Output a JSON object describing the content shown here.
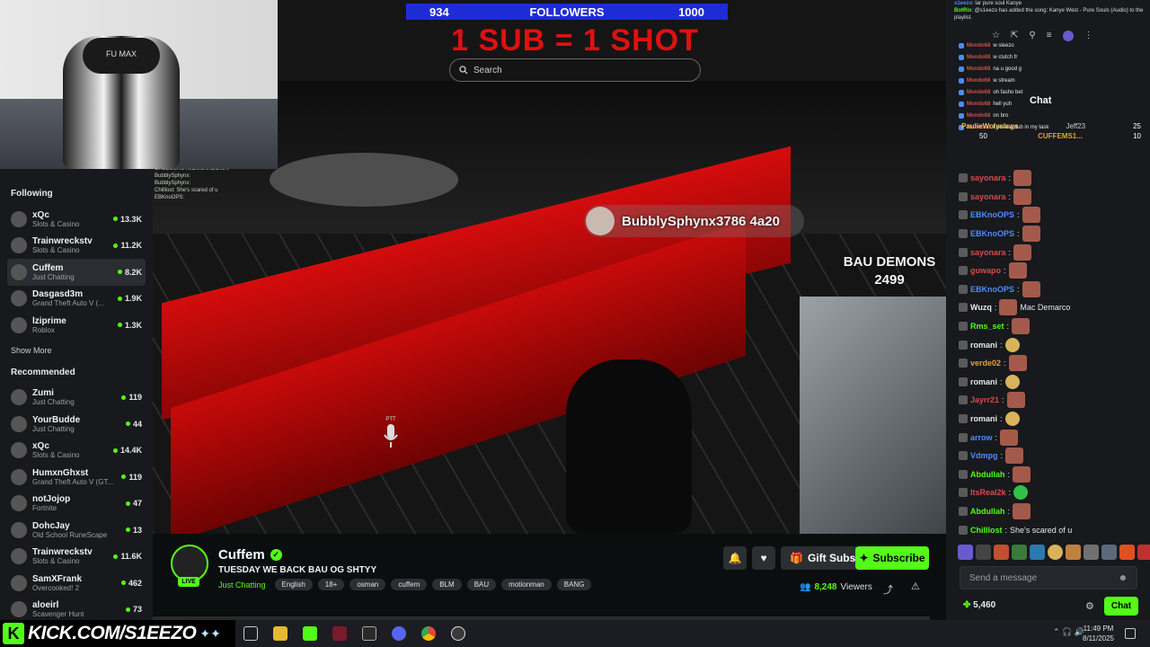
{
  "overlay": {
    "followers_current": "934",
    "followers_label": "FOLLOWERS",
    "followers_goal": "1000",
    "sub_text": "1 SUB = 1 SHOT",
    "search_placeholder": "Search",
    "nametag": "BubblySphynx3786 4a20",
    "bau_team": "BAU DEMONS",
    "bau_score": "2499",
    "chair_brand": "FU MAX",
    "mic_label": "PTT"
  },
  "sidebar": {
    "following_title": "Following",
    "following": [
      {
        "name": "xQc",
        "category": "Slots & Casino",
        "viewers": "13.3K"
      },
      {
        "name": "Trainwreckstv",
        "category": "Slots & Casino",
        "viewers": "11.2K"
      },
      {
        "name": "Cuffem",
        "category": "Just Chatting",
        "viewers": "8.2K"
      },
      {
        "name": "Dasgasd3m",
        "category": "Grand Theft Auto V (...",
        "viewers": "1.9K"
      },
      {
        "name": "lziprime",
        "category": "Roblox",
        "viewers": "1.3K"
      }
    ],
    "show_more": "Show More",
    "recommended_title": "Recommended",
    "recommended": [
      {
        "name": "Zumi",
        "category": "Just Chatting",
        "viewers": "119"
      },
      {
        "name": "YourBudde",
        "category": "Just Chatting",
        "viewers": "44"
      },
      {
        "name": "xQc",
        "category": "Slots & Casino",
        "viewers": "14.4K"
      },
      {
        "name": "HumxnGhxst",
        "category": "Grand Theft Auto V (GT...",
        "viewers": "119"
      },
      {
        "name": "notJojop",
        "category": "Fortnite",
        "viewers": "47"
      },
      {
        "name": "DohcJay",
        "category": "Old School RuneScape",
        "viewers": "13"
      },
      {
        "name": "Trainwreckstv",
        "category": "Slots & Casino",
        "viewers": "11.6K"
      },
      {
        "name": "SamXFrank",
        "category": "Overcooked! 2",
        "viewers": "462"
      },
      {
        "name": "aloeirl",
        "category": "Scavenger Hunt",
        "viewers": "73"
      }
    ]
  },
  "stream": {
    "streamer": "Cuffem",
    "live_badge": "LIVE",
    "title": "TUESDAY WE BACK BAU OG SHTYY",
    "category": "Just Chatting",
    "tags": [
      "English",
      "18+",
      "osman",
      "cuffem",
      "BLM",
      "BAU",
      "motionman",
      "BANG"
    ],
    "gift_label": "Gift Subs",
    "subscribe_label": "Subscribe",
    "viewers_count": "8,248",
    "viewers_label": "Viewers"
  },
  "chat": {
    "title": "Chat",
    "top_lines": [
      {
        "user": "s1eezo",
        "text": "lar pure soul Kanye"
      },
      {
        "user": "BotRix",
        "text": "@s1eezo has added the song: Kanye West - Pure Souls (Audio) to the playlist."
      }
    ],
    "small_lines": [
      {
        "user": "Mondo68",
        "text": "w sleezo"
      },
      {
        "user": "Mondo68",
        "text": "w clutch fr"
      },
      {
        "user": "Mondo68",
        "text": "na u good g"
      },
      {
        "user": "Mondo68",
        "text": "w stream"
      },
      {
        "user": "Mondo68",
        "text": "oh fasho bet"
      },
      {
        "user": "Mondo68",
        "text": "hell yuh"
      },
      {
        "user": "Mondo68",
        "text": "on bro"
      },
      {
        "user": "Mondo68",
        "text": "I need a dub in my task"
      }
    ],
    "pinned_left": "PaulieWolyslugs",
    "pinned_left_count": "50",
    "pinned_right_1": "Jeff23",
    "pinned_right_1_count": "25",
    "pinned_right_2": "CUFFEMS1...",
    "pinned_right_2_count": "10",
    "messages": [
      {
        "user": "sayonara",
        "color": "#d94a4a",
        "text": ""
      },
      {
        "user": "sayonara",
        "color": "#d94a4a",
        "text": ""
      },
      {
        "user": "EBKnoOPS",
        "color": "#4a8cff",
        "text": ""
      },
      {
        "user": "EBKnoOPS",
        "color": "#4a8cff",
        "text": ""
      },
      {
        "user": "sayonara",
        "color": "#d94a4a",
        "text": ""
      },
      {
        "user": "guwapo",
        "color": "#d94a4a",
        "text": ""
      },
      {
        "user": "EBKnoOPS",
        "color": "#4a8cff",
        "text": ""
      },
      {
        "user": "Wuzq",
        "color": "#e8e8e8",
        "text": "Mac Demarco"
      },
      {
        "user": "Rms_set",
        "color": "#53fc18",
        "text": ""
      },
      {
        "user": "romani",
        "color": "#e8e8e8",
        "text": ""
      },
      {
        "user": "verde02",
        "color": "#e8a030",
        "text": ""
      },
      {
        "user": "romani",
        "color": "#e8e8e8",
        "text": ""
      },
      {
        "user": "Jayrr21",
        "color": "#d94a4a",
        "text": ""
      },
      {
        "user": "romani",
        "color": "#e8e8e8",
        "text": ""
      },
      {
        "user": "arrow",
        "color": "#4a8cff",
        "text": ""
      },
      {
        "user": "Vdmpg",
        "color": "#4a8cff",
        "text": ""
      },
      {
        "user": "Abdullah",
        "color": "#53fc18",
        "text": ""
      },
      {
        "user": "ItsReal2k",
        "color": "#d94a4a",
        "text": ""
      },
      {
        "user": "Abdullah",
        "color": "#53fc18",
        "text": ""
      },
      {
        "user": "Chilllost",
        "color": "#53fc18",
        "text": "She's scared of u"
      }
    ],
    "send_placeholder": "Send a message",
    "points": "5,460",
    "chat_button": "Chat"
  },
  "taskbar": {
    "banner": "KICK.COM/S1EEZO",
    "time": "11:49 PM",
    "date": "8/11/2025"
  },
  "ingame_chat": [
    "CHEESURSTSOMUKRDOWN",
    "BubblySphynx:",
    "BubblySphynx:",
    "Chilllost: She's scared of u",
    "EBKnoOPS:"
  ]
}
